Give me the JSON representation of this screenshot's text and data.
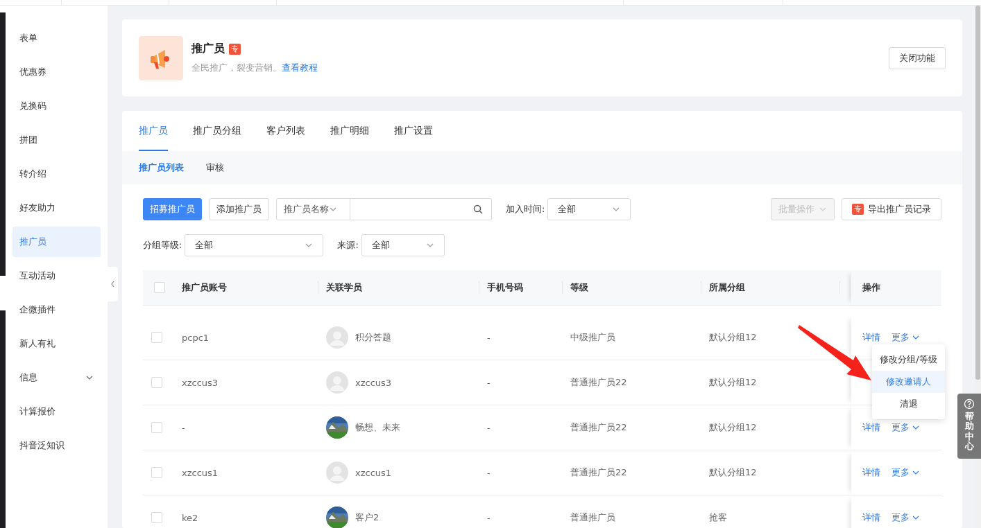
{
  "sidebar": {
    "items": [
      {
        "label": "表单",
        "selected": false
      },
      {
        "label": "优惠券",
        "selected": false
      },
      {
        "label": "兑换码",
        "selected": false
      },
      {
        "label": "拼团",
        "selected": false
      },
      {
        "label": "转介绍",
        "selected": false
      },
      {
        "label": "好友助力",
        "selected": false
      },
      {
        "label": "推广员",
        "selected": true
      },
      {
        "label": "互动活动",
        "selected": false
      },
      {
        "label": "企微插件",
        "selected": false
      },
      {
        "label": "新人有礼",
        "selected": false
      },
      {
        "label": "信息",
        "selected": false,
        "kind": "group",
        "expanded": false
      },
      {
        "label": "计算报价",
        "selected": false
      },
      {
        "label": "抖音泛知识",
        "selected": false
      }
    ]
  },
  "header": {
    "title": "推广员",
    "badge": "专",
    "description": "全民推广，裂变营销。",
    "link": "查看教程",
    "button": "关闭功能"
  },
  "tabs": [
    {
      "label": "推广员",
      "selected": true
    },
    {
      "label": "推广员分组",
      "selected": false
    },
    {
      "label": "客户列表",
      "selected": false
    },
    {
      "label": "推广明细",
      "selected": false
    },
    {
      "label": "推广设置",
      "selected": false
    }
  ],
  "subtabs": [
    {
      "label": "推广员列表",
      "selected": true
    },
    {
      "label": "审核",
      "selected": false
    }
  ],
  "toolbar": {
    "primary_button": "招募推广员",
    "add_button": "添加推广员",
    "search_type": "推广员名称",
    "join_time_label": "加入时间:",
    "join_time_value": "全部",
    "batch_button": {
      "label": "批量操作",
      "disabled": true
    },
    "export_button": {
      "badge": "专",
      "label": "导出推广员记录"
    },
    "group_label": "分组等级:",
    "group_value": "全部",
    "source_label": "来源:",
    "source_value": "全部"
  },
  "table": {
    "header_checked": false,
    "columns": [
      "推广员账号",
      "关联学员",
      "手机号码",
      "等级",
      "所属分组",
      "操作"
    ],
    "rows": [
      {
        "checked": false,
        "account": "pcpc1",
        "student": {
          "name": "积分答题",
          "kind": "default"
        },
        "phone": "-",
        "level": "中级推广员",
        "group": "默认分组12",
        "actions": [
          "详情",
          "更多"
        ]
      },
      {
        "checked": false,
        "account": "xzccus3",
        "student": {
          "name": "xzccus3",
          "kind": "default"
        },
        "phone": "-",
        "level": "普通推广员22",
        "group": "默认分组12"
      },
      {
        "checked": false,
        "account": "-",
        "student": {
          "name": "畅想、未来",
          "kind": "picture"
        },
        "phone": "-",
        "level": "普通推广员22",
        "group": "默认分组12",
        "actions": [
          "详情",
          "更多"
        ]
      },
      {
        "checked": false,
        "account": "xzccus1",
        "student": {
          "name": "xzccus1",
          "kind": "default"
        },
        "phone": "-",
        "level": "普通推广员22",
        "group": "默认分组12",
        "actions": [
          "详情",
          "更多"
        ]
      },
      {
        "checked": false,
        "account": "ke2",
        "student": {
          "name": "客户2",
          "kind": "picture"
        },
        "phone": "-",
        "level": "普通推广员",
        "group": "抢客",
        "actions": [
          "详情",
          "更多"
        ]
      }
    ]
  },
  "action_menu": {
    "items": [
      {
        "label": "修改分组/等级",
        "selected": false
      },
      {
        "label": "修改邀请人",
        "selected": true
      },
      {
        "label": "清退",
        "selected": false
      }
    ]
  },
  "help": {
    "label": "帮助中心"
  }
}
